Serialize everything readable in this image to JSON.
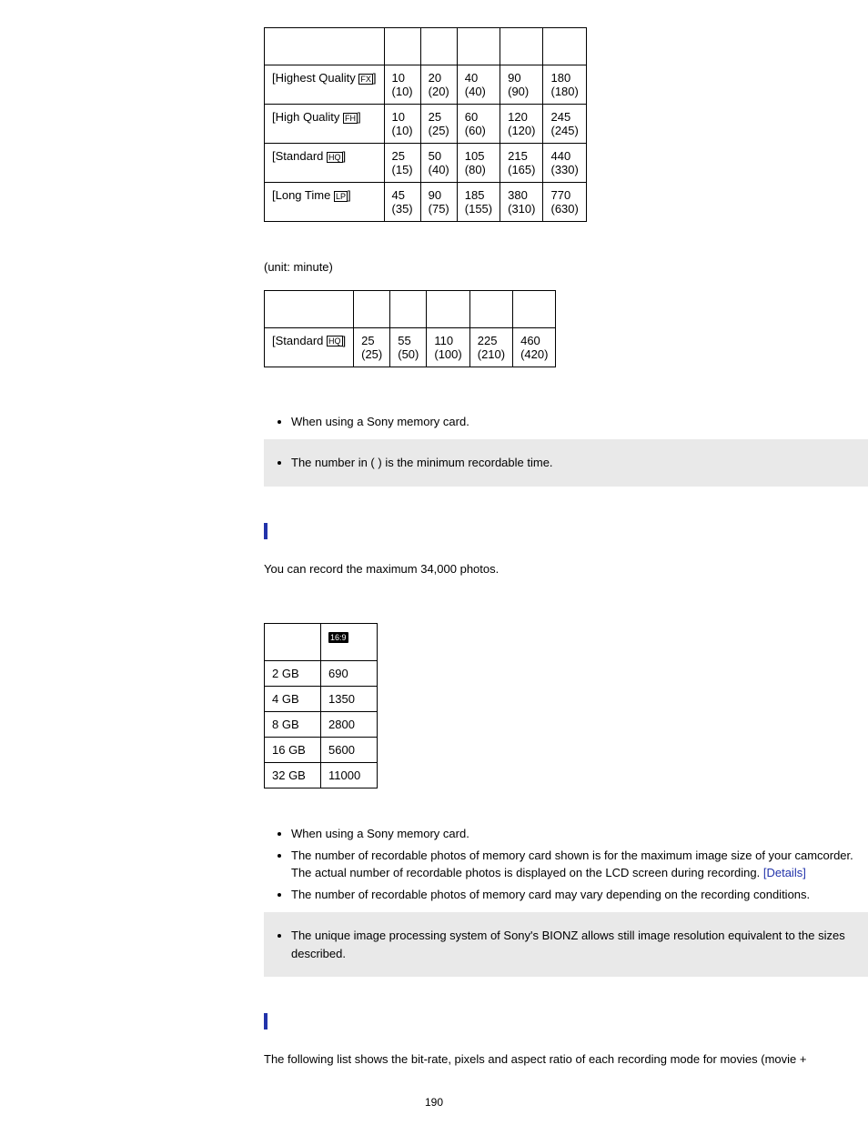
{
  "table1": {
    "rows": [
      {
        "label_prefix": "[Highest Quality ",
        "icon": "FX",
        "label_suffix": "]",
        "c": [
          "10",
          "20",
          "40",
          "90",
          "180"
        ],
        "p": [
          "(10)",
          "(20)",
          "(40)",
          "(90)",
          "(180)"
        ]
      },
      {
        "label_prefix": "[High Quality ",
        "icon": "FH",
        "label_suffix": "]",
        "c": [
          "10",
          "25",
          "60",
          "120",
          "245"
        ],
        "p": [
          "(10)",
          "(25)",
          "(60)",
          "(120)",
          "(245)"
        ]
      },
      {
        "label_prefix": "[Standard ",
        "icon": "HQ",
        "label_suffix": "]",
        "c": [
          "25",
          "50",
          "105",
          "215",
          "440"
        ],
        "p": [
          "(15)",
          "(40)",
          "(80)",
          "(165)",
          "(330)"
        ]
      },
      {
        "label_prefix": "[Long Time ",
        "icon": "LP",
        "label_suffix": "]",
        "c": [
          "45",
          "90",
          "185",
          "380",
          "770"
        ],
        "p": [
          "(35)",
          "(75)",
          "(155)",
          "(310)",
          "(630)"
        ]
      }
    ]
  },
  "unit_label": "(unit: minute)",
  "table2": {
    "row": {
      "label_prefix": "[Standard ",
      "icon": "HQ",
      "label_suffix": "]",
      "c": [
        "25",
        "55",
        "110",
        "225",
        "460"
      ],
      "p": [
        "(25)",
        "(50)",
        "(100)",
        "(210)",
        "(420)"
      ]
    }
  },
  "bullets1": [
    "When using a Sony memory card."
  ],
  "note1": [
    "The number in ( ) is the minimum recordable time."
  ],
  "photos_text": "You can record the maximum 34,000 photos.",
  "table3": {
    "header_icon": "16:9",
    "rows": [
      {
        "size": "2 GB",
        "count": "690"
      },
      {
        "size": "4 GB",
        "count": "1350"
      },
      {
        "size": "8 GB",
        "count": "2800"
      },
      {
        "size": "16 GB",
        "count": "5600"
      },
      {
        "size": "32 GB",
        "count": "11000"
      }
    ]
  },
  "bullets2": {
    "i0": "When using a Sony memory card.",
    "i1_a": "The number of recordable photos of memory card shown is for the maximum image size of your camcorder. The actual number of recordable photos is displayed on the LCD screen during recording. ",
    "i1_link": "[Details]",
    "i2": "The number of recordable photos of memory card may vary depending on the recording conditions."
  },
  "note2": [
    "The unique image processing system of Sony's BIONZ allows still image resolution equivalent to the sizes described."
  ],
  "bottom_text": "The following list shows the bit-rate, pixels and aspect ratio of each recording mode for movies (movie +",
  "page_number": "190"
}
